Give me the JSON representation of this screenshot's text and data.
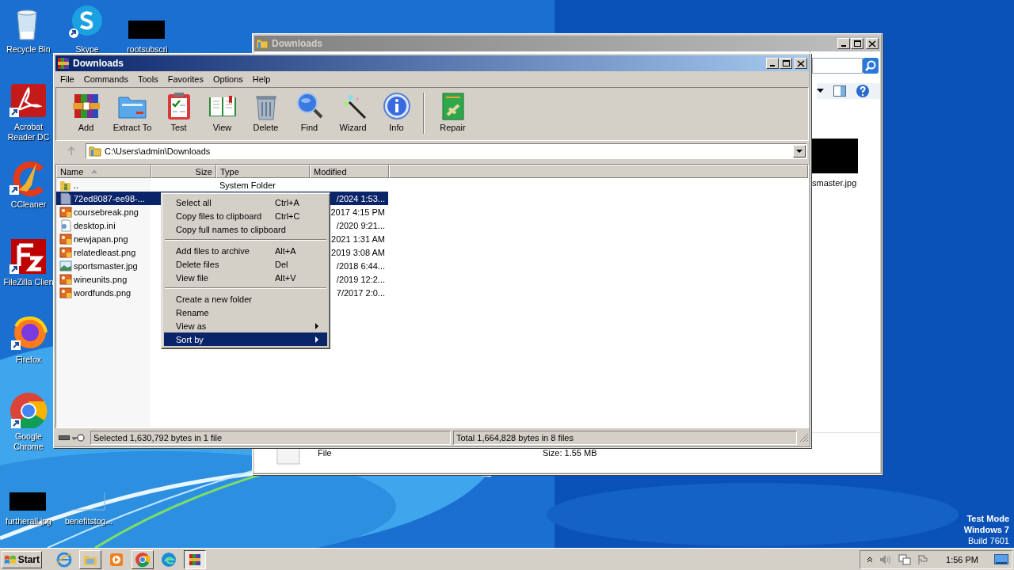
{
  "desktop": {
    "icons": [
      {
        "label": "Recycle Bin",
        "kind": "recycle"
      },
      {
        "label": "Skype",
        "kind": "skype"
      },
      {
        "label": "rootsubscri",
        "kind": "black-thumb"
      },
      {
        "label": "Acrobat Reader DC",
        "kind": "acrobat"
      },
      {
        "label": "CCleaner",
        "kind": "ccleaner"
      },
      {
        "label": "FileZilla Clien",
        "kind": "filezilla"
      },
      {
        "label": "Firefox",
        "kind": "firefox"
      },
      {
        "label": "Google Chrome",
        "kind": "chrome"
      },
      {
        "label": "furtherall.jpg",
        "kind": "black-thumb"
      },
      {
        "label": "benefitstog...",
        "kind": "blank-thumb"
      }
    ],
    "os_notice": [
      "Test Mode",
      "Windows 7",
      "Build 7601"
    ]
  },
  "explorer_window": {
    "title": "Downloads",
    "thumbnail_caption": "smaster.jpg",
    "details": {
      "type": "File",
      "size": "Size: 1.55 MB"
    }
  },
  "archiver_window": {
    "title": "Downloads",
    "menu": [
      "File",
      "Commands",
      "Tools",
      "Favorites",
      "Options",
      "Help"
    ],
    "toolbar": [
      {
        "label": "Add",
        "kind": "add"
      },
      {
        "label": "Extract To",
        "kind": "extract"
      },
      {
        "label": "Test",
        "kind": "test"
      },
      {
        "label": "View",
        "kind": "view"
      },
      {
        "label": "Delete",
        "kind": "delete"
      },
      {
        "label": "Find",
        "kind": "find"
      },
      {
        "label": "Wizard",
        "kind": "wizard"
      },
      {
        "label": "Info",
        "kind": "info"
      },
      {
        "label": "Repair",
        "kind": "repair",
        "separated": true
      }
    ],
    "address": "C:\\Users\\admin\\Downloads",
    "columns": [
      {
        "label": "Name",
        "sorted": true
      },
      {
        "label": "Size",
        "sorted": false
      },
      {
        "label": "Type",
        "sorted": false
      },
      {
        "label": "Modified",
        "sorted": false
      }
    ],
    "rows": [
      {
        "name": "..",
        "kind": "up-folder",
        "type": "System Folder",
        "selected": false
      },
      {
        "name": "72ed8087-ee98-...",
        "kind": "file",
        "modified": "/2024 1:53...",
        "selected": true
      },
      {
        "name": "coursebreak.png",
        "kind": "png",
        "modified": "2017 4:15 PM",
        "selected": false
      },
      {
        "name": "desktop.ini",
        "kind": "ini",
        "modified": "/2020 9:21...",
        "selected": false
      },
      {
        "name": "newjapan.png",
        "kind": "png",
        "modified": "2021 1:31 AM",
        "selected": false
      },
      {
        "name": "relatedleast.png",
        "kind": "png",
        "modified": "2019 3:08 AM",
        "selected": false
      },
      {
        "name": "sportsmaster.jpg",
        "kind": "jpg",
        "modified": "/2018 6:44...",
        "selected": false
      },
      {
        "name": "wineunits.png",
        "kind": "png",
        "modified": "/2019 12:2...",
        "selected": false
      },
      {
        "name": "wordfunds.png",
        "kind": "png",
        "modified": "7/2017 2:0...",
        "selected": false
      }
    ],
    "status": {
      "left": "Selected 1,630,792 bytes in 1 file",
      "right": "Total 1,664,828 bytes in 8 files"
    }
  },
  "context_menu": {
    "groups": [
      [
        {
          "label": "Select all",
          "shortcut": "Ctrl+A",
          "submenu": false,
          "selected": false
        },
        {
          "label": "Copy files to clipboard",
          "shortcut": "Ctrl+C",
          "submenu": false,
          "selected": false
        },
        {
          "label": "Copy full names to clipboard",
          "submenu": false,
          "selected": false
        }
      ],
      [
        {
          "label": "Add files to archive",
          "shortcut": "Alt+A",
          "submenu": false,
          "selected": false
        },
        {
          "label": "Delete files",
          "shortcut": "Del",
          "submenu": false,
          "selected": false
        },
        {
          "label": "View file",
          "shortcut": "Alt+V",
          "submenu": false,
          "selected": false
        }
      ],
      [
        {
          "label": "Create a new folder",
          "submenu": false,
          "selected": false
        },
        {
          "label": "Rename",
          "submenu": false,
          "selected": false
        },
        {
          "label": "View as",
          "submenu": true,
          "selected": false
        },
        {
          "label": "Sort by",
          "submenu": true,
          "selected": true
        }
      ]
    ]
  },
  "taskbar": {
    "start": "Start",
    "apps": [
      {
        "kind": "ie",
        "active": false
      },
      {
        "kind": "explorer",
        "active": false
      },
      {
        "kind": "media",
        "active": false
      },
      {
        "kind": "chrome",
        "active": false
      },
      {
        "kind": "edge",
        "active": false
      },
      {
        "kind": "archiver",
        "active": true
      }
    ],
    "time": "1:56 PM"
  }
}
